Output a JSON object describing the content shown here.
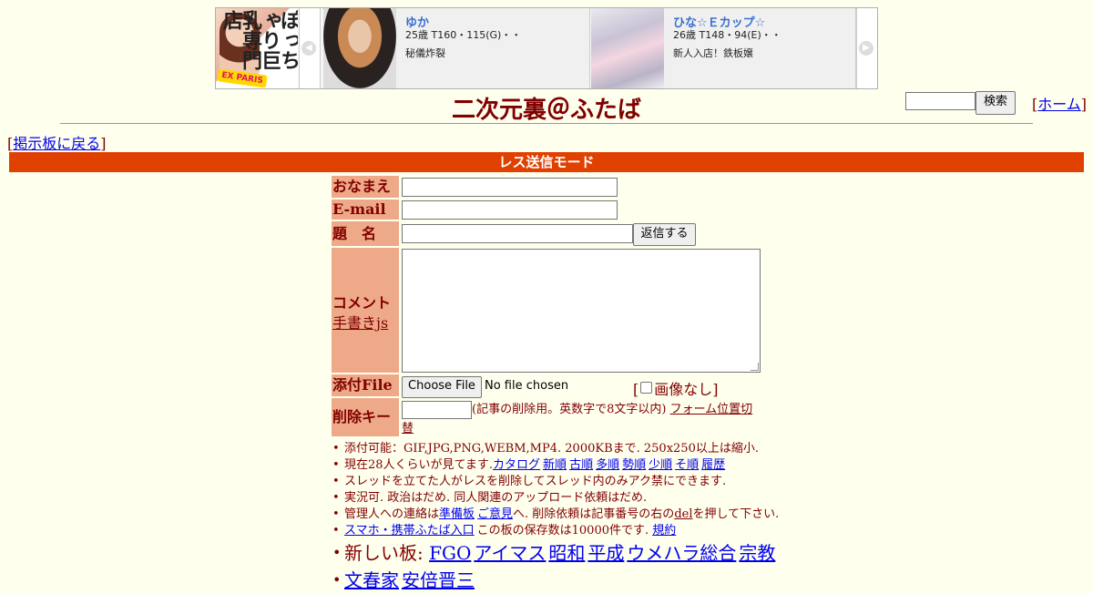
{
  "banner": {
    "shop_logo_text": "ぽっちゃり巨乳専門店",
    "shop_logo_badge": "EX PARIS",
    "prev_arrow": "◀",
    "next_arrow": "▶",
    "cards": [
      {
        "name": "ゆか",
        "spec": "25歳 T160・115(G)・・",
        "message": "秘儀炸裂"
      },
      {
        "name": "ひな☆Ｅカップ☆",
        "spec": "26歳 T148・94(E)・・",
        "message": "新人入店！鉄板嬢"
      }
    ]
  },
  "header": {
    "title": "二次元裏＠ふたば",
    "search_button": "検索",
    "home_link": "ホーム",
    "back_link": "掲示板に戻る",
    "bracket_open": "[",
    "bracket_close": "]"
  },
  "mode_bar": "レス送信モード",
  "form": {
    "name_label": "おなまえ",
    "email_label": "E-mail",
    "subject_label": "題　名",
    "submit_button": "返信する",
    "comment_label": "コメント",
    "handwriting_link": "手書きjs",
    "file_label": "添付File",
    "choose_file_button": "Choose File",
    "file_status": "No file chosen",
    "no_image_label": "画像なし",
    "delkey_label": "削除キー",
    "delkey_note": "(記事の削除用。英数字で8文字以内)",
    "form_toggle_link_a": "フォーム位置切",
    "form_toggle_link_b": "替"
  },
  "notes": {
    "line1": "添付可能：GIF,JPG,PNG,WEBM,MP4. 2000KBまで. 250x250以上は縮小.",
    "line2_prefix": "現在28人くらいが見てます.",
    "line2_links": [
      "カタログ",
      "新順",
      "古順",
      "多順",
      "勢順",
      "少順",
      "そ順",
      "履歴"
    ],
    "line3": "スレッドを立てた人がレスを削除してスレッド内のみアク禁にできます.",
    "line4": "実況可. 政治はだめ. 同人関連のアップロード依頼はだめ.",
    "line5_a": "管理人への連絡は",
    "line5_link1": "準備板",
    "line5_link2": "ご意見",
    "line5_b": "へ. 削除依頼は記事番号の右の",
    "line5_del": "del",
    "line5_c": "を押して下さい.",
    "line6_link": "スマホ・携帯ふたば入口",
    "line6_text": "この板の保存数は10000件です.",
    "line6_rules": "規約",
    "line7_prefix": "新しい板:",
    "line7_links": [
      "FGO",
      "アイマス",
      "昭和",
      "平成",
      "ウメハラ総合",
      "宗教"
    ],
    "line8_links": [
      "文春家",
      "安倍晋三"
    ]
  }
}
